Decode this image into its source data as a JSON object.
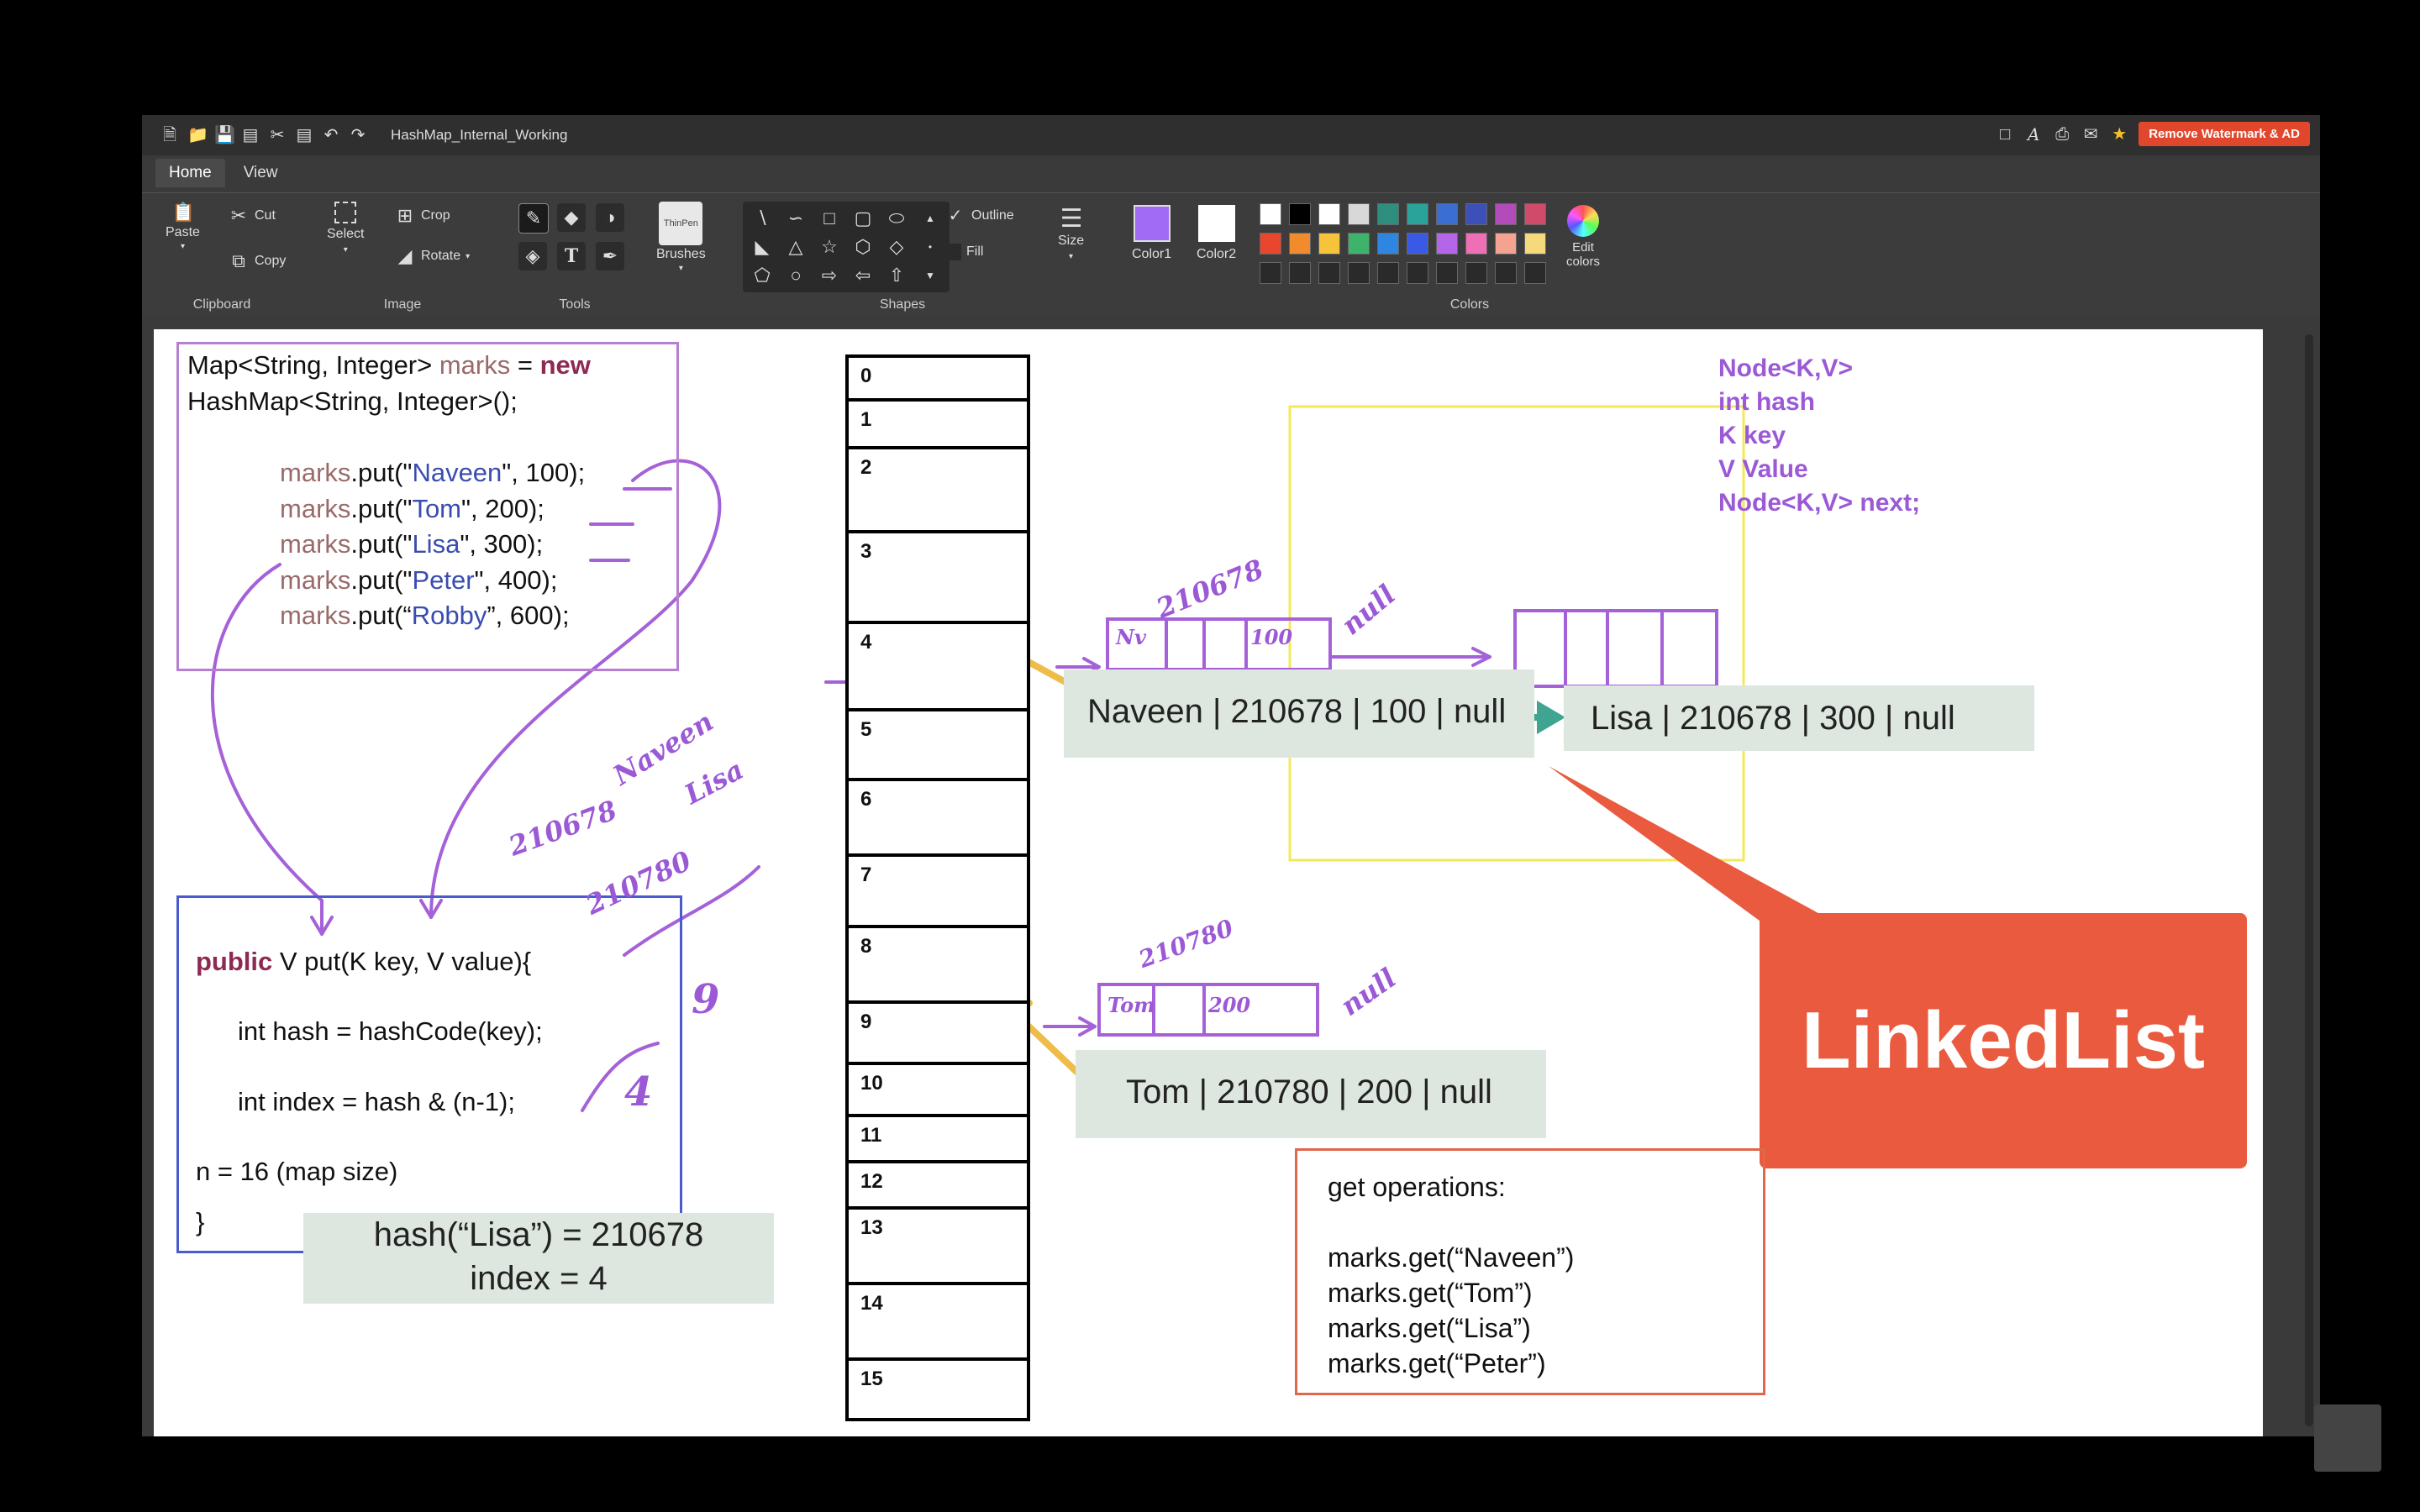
{
  "window": {
    "title": "HashMap_Internal_Working",
    "watermark_button": "Remove Watermark & AD",
    "tabs": [
      {
        "label": "Home",
        "active": true
      },
      {
        "label": "View",
        "active": false
      }
    ]
  },
  "ribbon": {
    "clipboard": {
      "paste": "Paste",
      "cut": "Cut",
      "copy": "Copy",
      "group": "Clipboard"
    },
    "image": {
      "select": "Select",
      "crop": "Crop",
      "rotate": "Rotate",
      "group": "Image"
    },
    "tools": {
      "group": "Tools"
    },
    "brushes": {
      "label": "Brushes",
      "thumb": "ThinPen"
    },
    "shapes": {
      "outline": "Outline",
      "fill": "Fill",
      "group": "Shapes"
    },
    "size": {
      "label": "Size"
    },
    "colors": {
      "color1": "Color1",
      "color2": "Color2",
      "edit": "Edit colors",
      "group": "Colors",
      "color1_value": "#a26bf5",
      "color2_value": "#ffffff",
      "palette_row1": [
        "#ffffff",
        "#000000",
        "#ffffff",
        "#d8d8d8",
        "#2f8f7f",
        "#2aa39a",
        "#3b6ed3",
        "#3d4fb8",
        "#b14cb8",
        "#d04a6a"
      ],
      "palette_row2": [
        "#e8472e",
        "#f28a2e",
        "#f6c33b",
        "#3db36b",
        "#2f86e0",
        "#3a5ae6",
        "#b566e8",
        "#ef6fb7",
        "#f3a38f",
        "#f6d97a",
        "#6fd2f0"
      ]
    }
  },
  "code": {
    "line1a": "Map<String, Integer>",
    "line1b": "marks",
    "line1c": "=",
    "line1d": "new",
    "line2": "HashMap<String, Integer>();",
    "puts": [
      {
        "obj": "marks",
        "pre": ".put(\"",
        "key": "Naveen",
        "post": "\", 100);"
      },
      {
        "obj": "marks",
        "pre": ".put(\"",
        "key": "Tom",
        "post": "\", 200);"
      },
      {
        "obj": "marks",
        "pre": ".put(\"",
        "key": "Lisa",
        "post": "\", 300);"
      },
      {
        "obj": "marks",
        "pre": ".put(\"",
        "key": "Peter",
        "post": "\", 400);"
      },
      {
        "obj": "marks",
        "pre": ".put(“",
        "key": "Robby",
        "post": "”, 600);"
      }
    ]
  },
  "put_method": {
    "sig_kw": "public",
    "sig_rest": " V put(K key, V value){",
    "hash_line": "int hash = hashCode(key);",
    "index_line": "int index = hash & (n-1);",
    "n_line": "n = 16 (map size)",
    "close": "}"
  },
  "note_hash": {
    "line1": "hash(“Lisa”) = 210678",
    "line2": "index = 4"
  },
  "buckets": [
    "0",
    "1",
    "2",
    "3",
    "4",
    "5",
    "6",
    "7",
    "8",
    "9",
    "10",
    "11",
    "12",
    "13",
    "14",
    "15"
  ],
  "nodes": {
    "naveen": "Naveen | 210678 | 100 | null",
    "lisa": "Lisa | 210678 | 300 | null",
    "tom": "Tom | 210780 | 200 | null"
  },
  "node_struct": [
    "Node<K,V>",
    "int hash",
    "K key",
    "V Value",
    "Node<K,V> next;"
  ],
  "banner": "LinkedList",
  "get_ops": {
    "title": "get operations:",
    "lines": [
      "marks.get(“Naveen”)",
      "marks.get(“Tom”)",
      "marks.get(“Lisa”)",
      "marks.get(“Peter”)"
    ]
  },
  "handwriting": {
    "naveen": "Naveen",
    "lisa": "Lisa",
    "h1": "210678",
    "h2": "210780",
    "nine": "9",
    "four": "4",
    "h3": "210678",
    "h4": "210780",
    "null1": "null",
    "null2": "null",
    "nv": "Nv",
    "n100": "100",
    "tom": "Tom",
    "n200": "200"
  }
}
